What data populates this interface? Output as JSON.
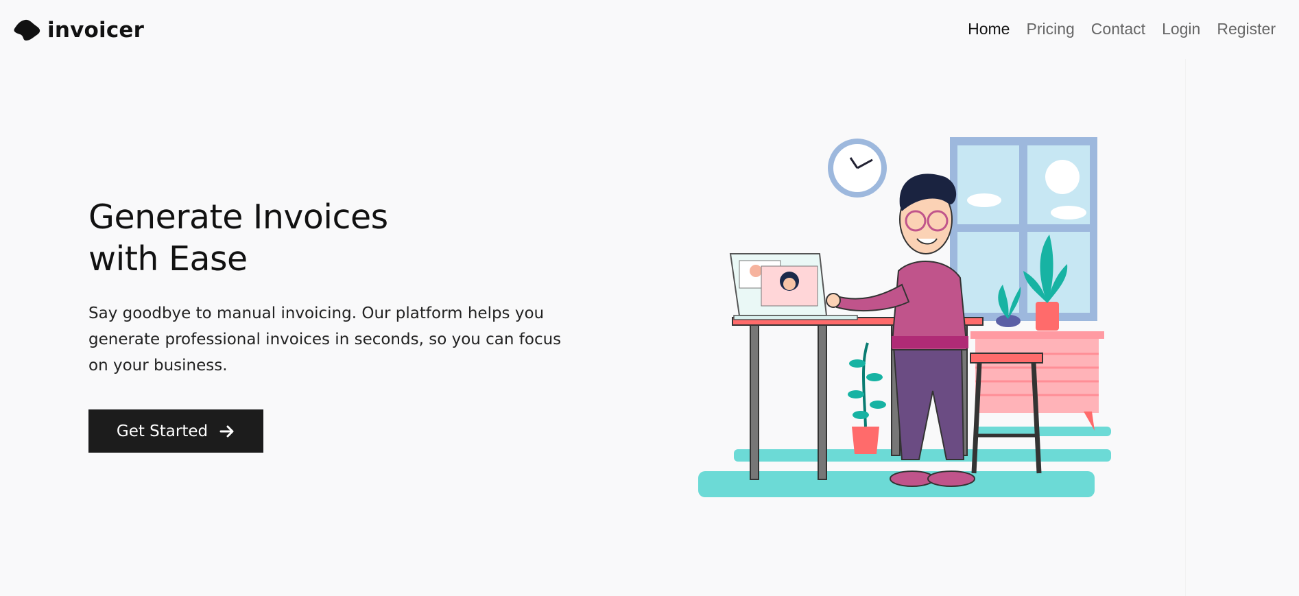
{
  "brand": {
    "name": "invoicer",
    "logo_icon": "blob-logo-icon"
  },
  "nav": {
    "items": [
      {
        "label": "Home",
        "active": true
      },
      {
        "label": "Pricing",
        "active": false
      },
      {
        "label": "Contact",
        "active": false
      },
      {
        "label": "Login",
        "active": false
      },
      {
        "label": "Register",
        "active": false
      }
    ]
  },
  "hero": {
    "title_line1": "Generate Invoices",
    "title_line2": "with Ease",
    "description": "Say goodbye to manual invoicing. Our platform helps you generate professional invoices in seconds, so you can focus on your business.",
    "cta_label": "Get Started",
    "cta_icon": "arrow-right-icon",
    "illustration": "man-at-desk-video-call-illustration"
  },
  "colors": {
    "background": "#f9f9fa",
    "text_primary": "#111111",
    "nav_inactive": "#666666",
    "cta_background": "#1c1c1c",
    "accent_teal": "#6cdad6",
    "accent_pink": "#c0548b",
    "accent_coral": "#ff6b6b"
  }
}
